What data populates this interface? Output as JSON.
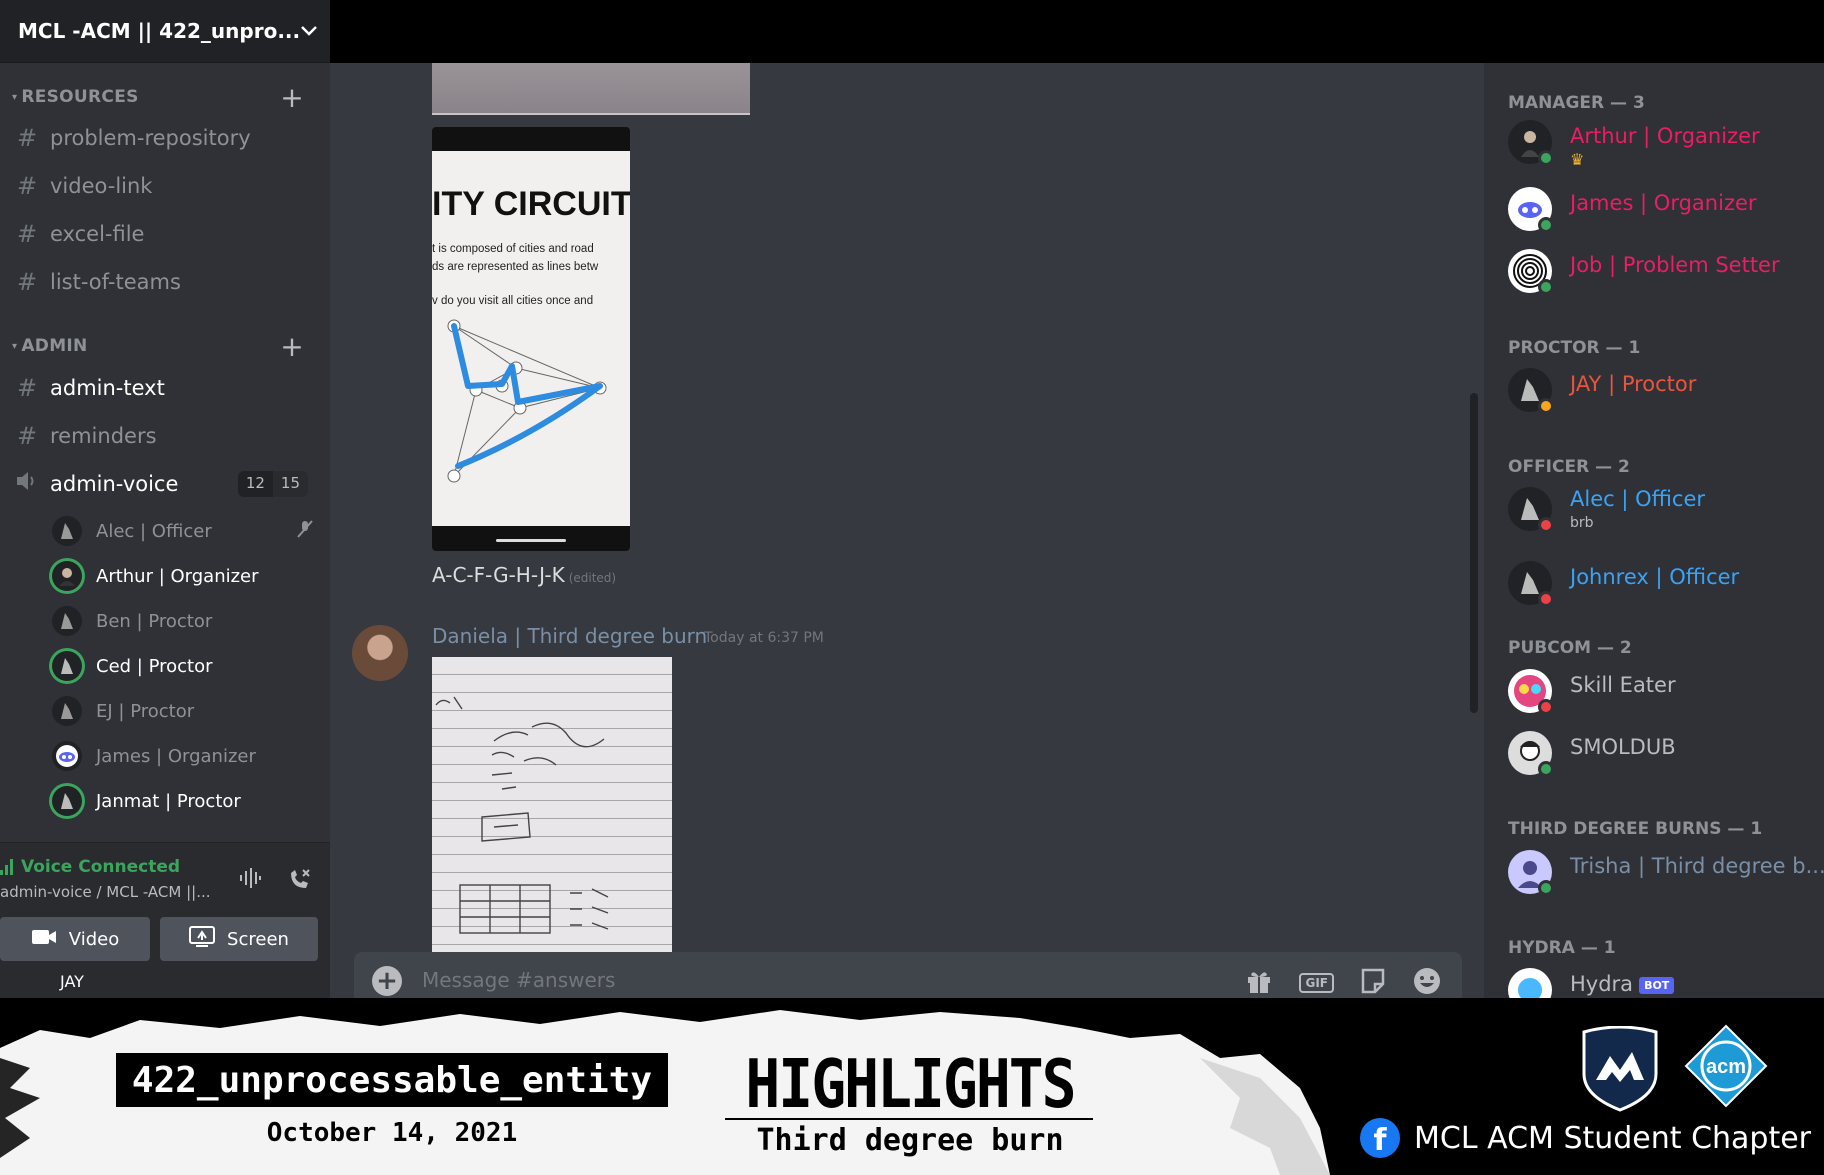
{
  "server": {
    "name": "MCL -ACM || 422_unpro..."
  },
  "sidebar": {
    "categories": [
      {
        "label": "RESOURCES"
      },
      {
        "label": "ADMIN"
      }
    ],
    "resource_channels": [
      "problem-repository",
      "video-link",
      "excel-file",
      "list-of-teams"
    ],
    "admin_channels": [
      "admin-text",
      "reminders"
    ],
    "voice_channel": {
      "name": "admin-voice",
      "count": "12",
      "limit": "15"
    },
    "voice_users": [
      "Alec | Officer",
      "Arthur | Organizer",
      "Ben | Proctor",
      "Ced | Proctor",
      "EJ | Proctor",
      "James | Organizer",
      "Janmat | Proctor"
    ]
  },
  "voice_panel": {
    "status": "Voice Connected",
    "subtitle": "admin-voice / MCL -ACM ||...",
    "video_label": "Video",
    "screen_label": "Screen",
    "user": "JAY"
  },
  "chat": {
    "phone_image": {
      "title": "ITY CIRCUIT",
      "lines": [
        "t is composed of cities and road",
        "ds are represented as lines betw",
        "v do you visit all cities once and"
      ]
    },
    "message_text": "A-C-F-G-H-J-K",
    "edited_label": "(edited)",
    "author": "Daniela | Third degree burn",
    "timestamp": "Today at 6:37 PM",
    "composer_placeholder": "Message #answers",
    "gif_label": "GIF"
  },
  "members": {
    "groups": [
      {
        "role": "MANAGER — 3"
      },
      {
        "role": "PROCTOR — 1"
      },
      {
        "role": "OFFICER — 2"
      },
      {
        "role": "PUBCOM — 2"
      },
      {
        "role": "THIRD DEGREE BURNS — 1"
      },
      {
        "role": "HYDRA — 1"
      }
    ],
    "list": [
      {
        "name": "Arthur | Organizer",
        "color": "#e91e63"
      },
      {
        "name": "James | Organizer",
        "color": "#e91e63"
      },
      {
        "name": "Job | Problem Setter",
        "color": "#e91e63"
      },
      {
        "name": "JAY | Proctor",
        "color": "#e8553d"
      },
      {
        "name": "Alec | Officer",
        "color": "#3aa3f5",
        "sub": "brb"
      },
      {
        "name": "Johnrex | Officer",
        "color": "#3aa3f5"
      },
      {
        "name": "Skill Eater",
        "color": "#b9bbbe"
      },
      {
        "name": "SMOLDUB",
        "color": "#b9bbbe"
      },
      {
        "name": "Trisha | Third degree b...",
        "color": "#7a8fa6"
      },
      {
        "name": "Hydra",
        "color": "#b9bbbe",
        "badge": "BOT"
      }
    ]
  },
  "banner": {
    "team": "422_unprocessable_entity",
    "date": "October 14, 2021",
    "title": "HIGHLIGHTS",
    "subtitle": "Third degree burn",
    "page": "MCL ACM Student Chapter",
    "acm_text": "acm"
  },
  "colors": {
    "background": "#36393f",
    "sidebar": "#2f3136",
    "online": "#3ba55d",
    "dnd": "#ed4245",
    "idle": "#faa61a",
    "brand": "#5865f2"
  }
}
